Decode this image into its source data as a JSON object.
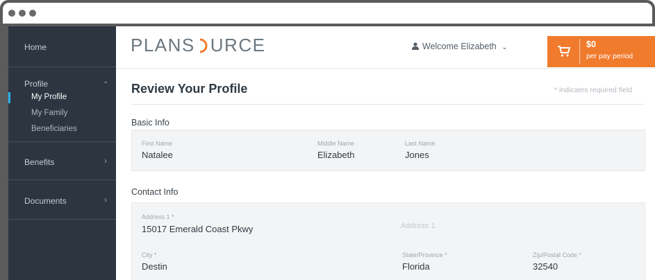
{
  "sidebar": {
    "home": "Home",
    "profile": "Profile",
    "profile_sub": [
      "My Profile",
      "My Family",
      "Beneficiaries"
    ],
    "benefits": "Benefits",
    "documents": "Documents"
  },
  "header": {
    "logo_left": "PLANS",
    "logo_right": "URCE",
    "welcome": "Welcome Elizabeth",
    "cart_amount": "$0",
    "cart_period": "per pay period"
  },
  "main": {
    "title": "Review Your Profile",
    "required_note": "* indicates required field",
    "basic_info": {
      "section_label": "Basic Info",
      "first_name_label": "First Name",
      "first_name": "Natalee",
      "middle_name_label": "Middle Name",
      "middle_name": "Elizabeth",
      "last_name_label": "Last Name",
      "last_name": "Jones"
    },
    "contact_info": {
      "section_label": "Contact Info",
      "address1_label": "Address 1 *",
      "address1": "15017 Emerald Coast Pkwy",
      "address2_placeholder": "Address 1",
      "city_label": "City *",
      "city": "Destin",
      "state_label": "State/Province *",
      "state": "Florida",
      "zip_label": "Zip/Postal Code *",
      "zip": "32540"
    }
  },
  "colors": {
    "accent": "#f07b2d",
    "sidebar": "#2c3540",
    "active_indicator": "#27b4e8"
  },
  "icons": [
    "user-icon",
    "cart-icon",
    "chevron-down-icon",
    "chevron-right-icon"
  ]
}
